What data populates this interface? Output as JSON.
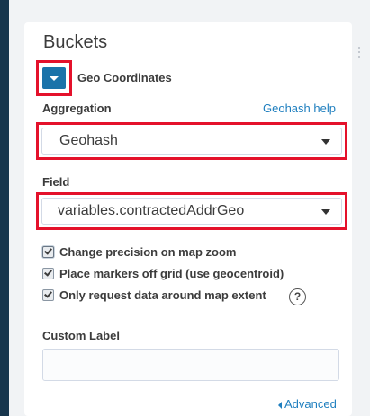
{
  "panel": {
    "title": "Buckets"
  },
  "aggregation_header": {
    "name": "Geo Coordinates",
    "toggle_icon": "chevron-down-icon"
  },
  "aggregation": {
    "label": "Aggregation",
    "help_link": "Geohash help",
    "selected": "Geohash"
  },
  "field": {
    "label": "Field",
    "selected": "variables.contractedAddrGeo"
  },
  "options": [
    {
      "label": "Change precision on map zoom",
      "checked": true
    },
    {
      "label": "Place markers off grid (use geocentroid)",
      "checked": true
    },
    {
      "label": "Only request data around map extent",
      "checked": true
    }
  ],
  "help_icon_text": "?",
  "custom_label": {
    "label": "Custom Label",
    "value": ""
  },
  "advanced_link": "Advanced",
  "colors": {
    "accent": "#1a73a9",
    "link": "#1f7fbf",
    "highlight": "#e4112b",
    "sidebar": "#17364d"
  }
}
